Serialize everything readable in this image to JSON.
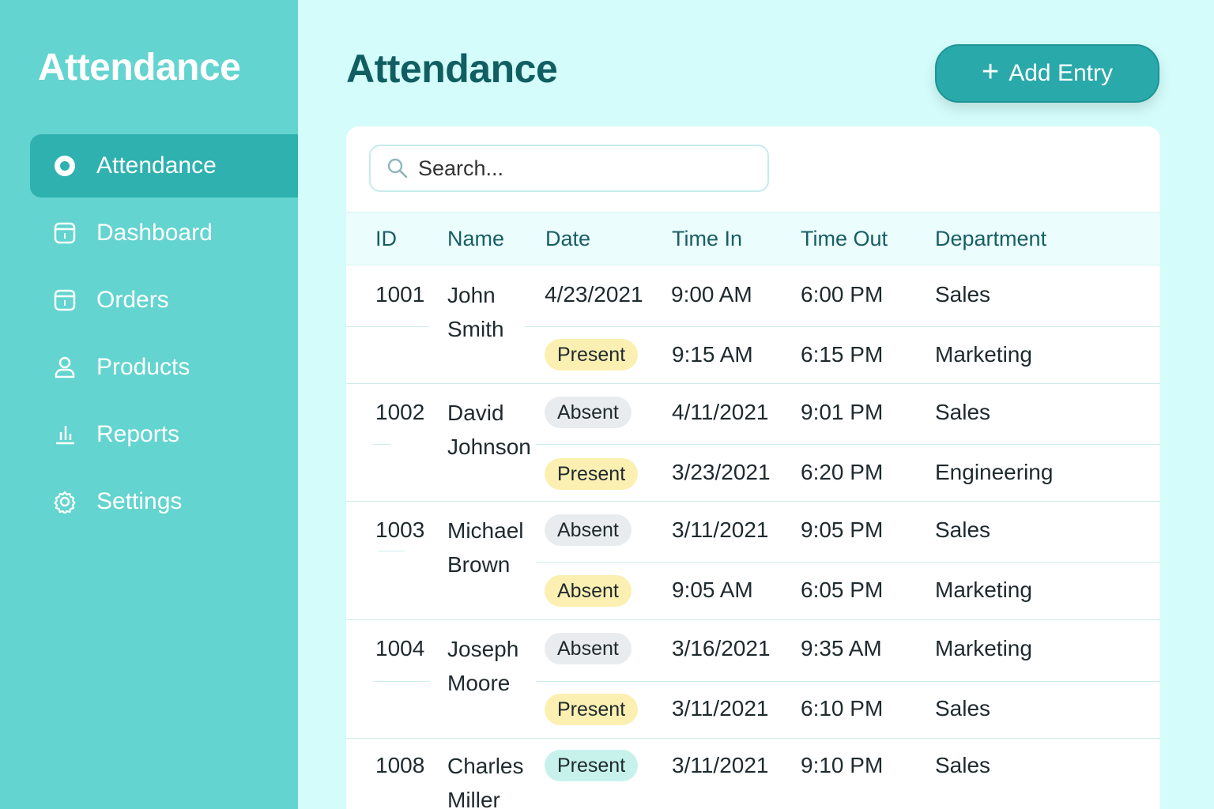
{
  "sidebar": {
    "brand": "Attendance",
    "items": [
      {
        "label": "Attendance",
        "icon": "radio-dot-icon",
        "active": true
      },
      {
        "label": "Dashboard",
        "icon": "calendar-icon"
      },
      {
        "label": "Orders",
        "icon": "calendar-icon"
      },
      {
        "label": "Products",
        "icon": "user-icon"
      },
      {
        "label": "Reports",
        "icon": "bar-chart-icon"
      },
      {
        "label": "Settings",
        "icon": "gear-icon"
      }
    ]
  },
  "header": {
    "title": "Attendance",
    "add_button": "Add Entry"
  },
  "search": {
    "placeholder": "Search..."
  },
  "table": {
    "columns": [
      "ID",
      "Name",
      "Date",
      "Time In",
      "Time Out",
      "Department"
    ],
    "rows": [
      {
        "id": "1001",
        "name": "John Smith",
        "line1": {
          "date": "4/23/2021",
          "time_in": "9:00 AM",
          "time_out": "6:00 PM",
          "department": "Sales"
        },
        "line2": {
          "status": "Present",
          "time_in": "9:15 AM",
          "time_out": "6:15 PM",
          "department": "Marketing"
        }
      },
      {
        "id": "1002",
        "name": "David Johnson",
        "line1": {
          "status": "Absent",
          "date": "4/11/2021",
          "time_out": "9:01 PM",
          "department": "Sales"
        },
        "line2": {
          "status": "Present",
          "date": "3/23/2021",
          "time_out": "6:20 PM",
          "department": "Engineering"
        }
      },
      {
        "id": "1003",
        "name": "Michael Brown",
        "line1": {
          "status": "Absent",
          "date": "3/11/2021",
          "time_out": "9:05 PM",
          "department": "Sales"
        },
        "line2": {
          "status": "Absent",
          "time_in": "9:05 AM",
          "time_out": "6:05 PM",
          "department": "Marketing"
        }
      },
      {
        "id": "1004",
        "name": "Joseph Moore",
        "line1": {
          "status": "Absent",
          "date": "3/16/2021",
          "time_out": "9:35 AM",
          "department": "Marketing"
        },
        "line2": {
          "status": "Present",
          "date": "3/11/2021",
          "time_out": "6:10 PM",
          "department": "Sales"
        }
      },
      {
        "id": "1008",
        "name": "Charles Miller",
        "line1": {
          "status": "Present",
          "date": "3/11/2021",
          "time_out": "9:10 PM",
          "department": "Sales"
        }
      }
    ]
  },
  "colors": {
    "sidebar": "#63d4cf",
    "sidebar_active": "#2fb1b0",
    "page_bg": "#d3fcfa",
    "title": "#115e62",
    "button": "#2aa9aa",
    "present_badge": "#fbf0b2",
    "absent_badge": "#e9ecee",
    "present_teal_badge": "#c7f2ec"
  }
}
